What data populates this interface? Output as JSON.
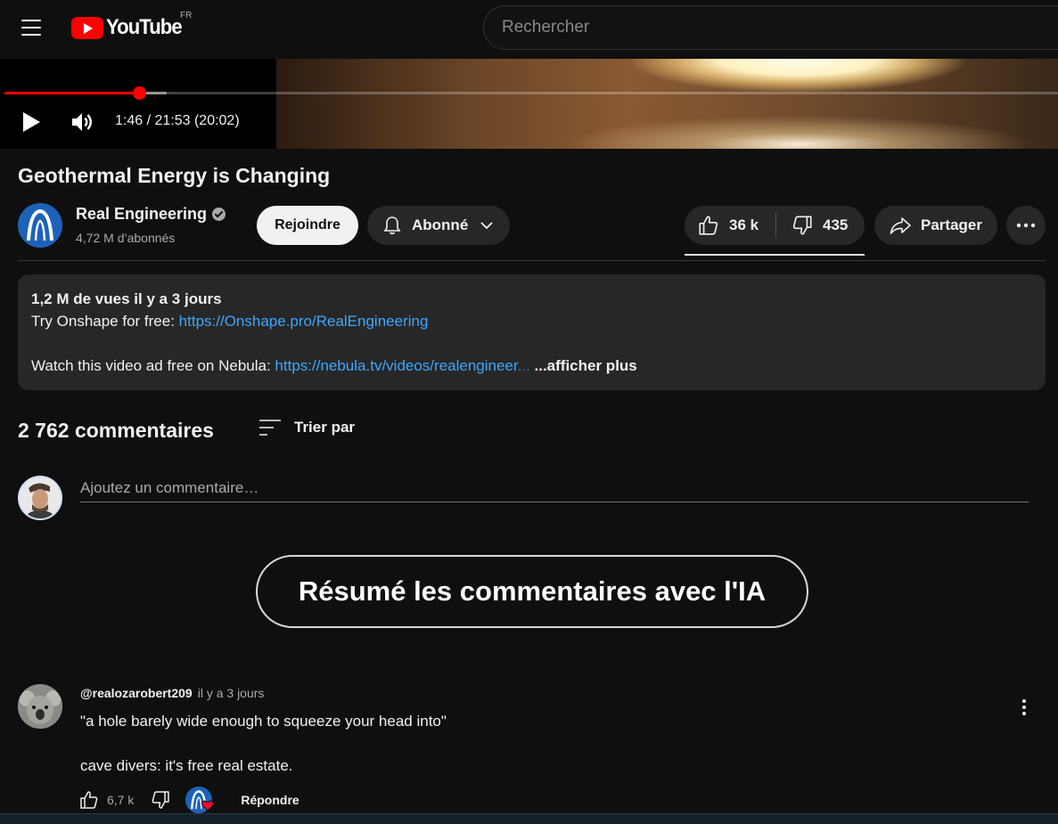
{
  "header": {
    "logo_text": "YouTube",
    "country": "FR",
    "search_placeholder": "Rechercher"
  },
  "player": {
    "time": "1:46 / 21:53 (20:02)",
    "progress_fraction": 0.128,
    "buffered_fraction": 0.154
  },
  "video": {
    "title": "Geothermal Energy is Changing",
    "channel": {
      "name": "Real Engineering",
      "subscribers": "4,72 M d’abonnés"
    },
    "join_label": "Rejoindre",
    "subscribed_label": "Abonné",
    "likes": "36 k",
    "dislikes": "435",
    "share_label": "Partager"
  },
  "description": {
    "meta": "1,2 M de vues  il y a 3 jours",
    "line1_prefix": "Try Onshape for free: ",
    "line1_link": "https://Onshape.pro/RealEngineering",
    "line2_prefix": "Watch this video ad free on Nebula: ",
    "line2_link": "https://nebula.tv/videos/realengineer",
    "line2_fade": "...",
    "more_label": " ...afficher plus"
  },
  "comments": {
    "count_label": "2 762 commentaires",
    "sort_label": "Trier par",
    "add_placeholder": "Ajoutez un commentaire…",
    "ai_button_label": "Résumé les commentaires avec l'IA",
    "items": [
      {
        "author": "@realozarobert209",
        "time": "il y a 3 jours",
        "line1": "\"a hole barely wide enough to squeeze your head into\"",
        "line2": "",
        "line3": "cave divers: it's free real estate.",
        "likes": "6,7 k",
        "reply_label": "Répondre"
      }
    ]
  },
  "colors": {
    "accent_red": "#ff0000",
    "link_blue": "#3ea6ff",
    "background": "#0f0f0f",
    "chip": "#272727"
  },
  "icons": [
    "menu-icon",
    "youtube-logo-icon",
    "play-icon",
    "volume-icon",
    "verified-icon",
    "bell-icon",
    "chevron-down-icon",
    "thumbs-up-icon",
    "thumbs-down-icon",
    "share-icon",
    "more-icon",
    "sort-icon",
    "heart-icon",
    "kebab-icon"
  ]
}
